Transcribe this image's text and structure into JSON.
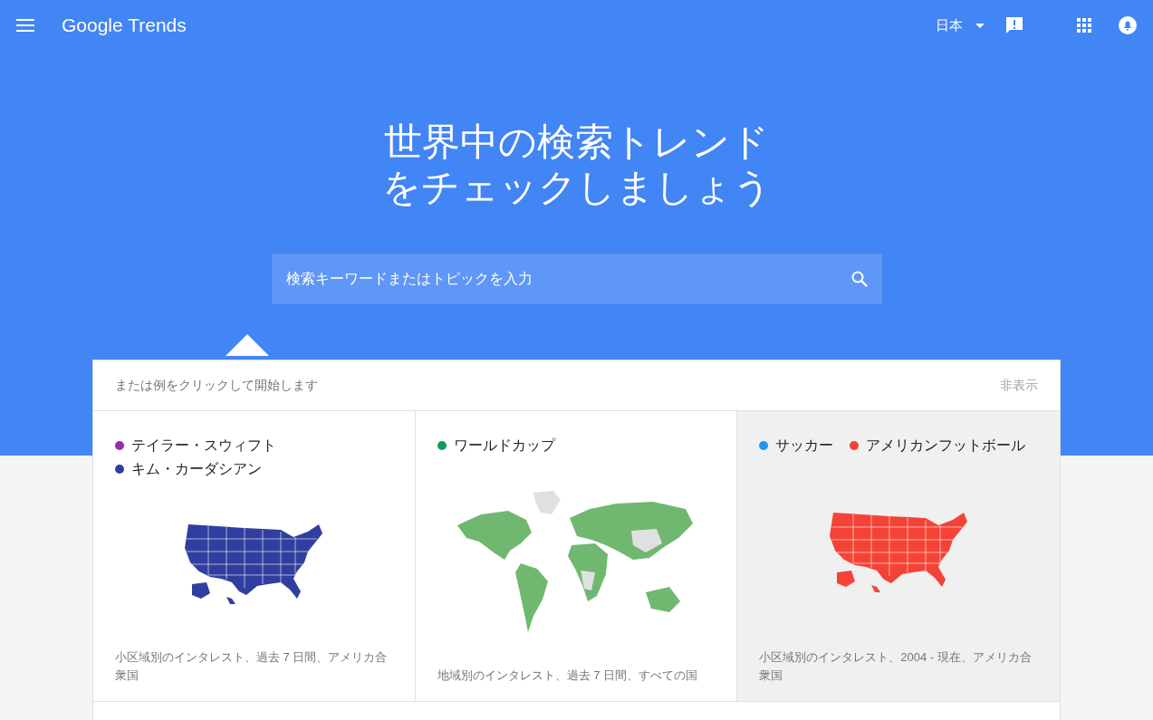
{
  "header": {
    "logo": "Google Trends",
    "region": "日本"
  },
  "hero": {
    "title_lines": [
      "世界中の検索トレンド",
      "をチェックしましょう"
    ]
  },
  "search": {
    "placeholder": "検索キーワードまたはトピックを入力"
  },
  "examples": {
    "intro": "または例をクリックして開始します",
    "hide": "非表示",
    "cards": [
      {
        "selected": false,
        "kind": "usa",
        "terms": [
          {
            "label": "テイラー・スウィフト",
            "color": "#9c27b0"
          },
          {
            "label": "キム・カーダシアン",
            "color": "#303f9f"
          }
        ],
        "caption": "小区域別のインタレスト、過去 7 日間、アメリカ合衆国"
      },
      {
        "selected": false,
        "kind": "world",
        "terms": [
          {
            "label": "ワールドカップ",
            "color": "#0f9d58"
          }
        ],
        "caption": "地域別のインタレスト、過去 7 日間、すべての国"
      },
      {
        "selected": true,
        "kind": "usa",
        "terms": [
          {
            "label": "サッカー",
            "color": "#2196f3"
          },
          {
            "label": "アメリカンフットボール",
            "color": "#f44336"
          }
        ],
        "caption": "小区域別のインタレスト、2004 - 現在、アメリカ合衆国"
      }
    ]
  }
}
